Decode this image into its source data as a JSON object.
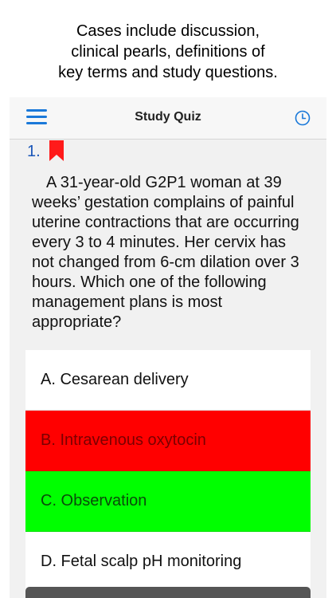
{
  "caption": {
    "line1": "Cases include discussion,",
    "line2": "clinical pearls, definitions of",
    "line3": "key terms and study questions."
  },
  "navbar": {
    "title": "Study Quiz",
    "menu_icon": "hamburger-menu-icon",
    "timer_icon": "clock-icon"
  },
  "question": {
    "number": "1.",
    "bookmark_icon": "bookmark-icon",
    "stem": "A 31-year-old G2P1 woman at 39 weeks’ gestation complains of painful uterine contractions that are occurring every 3 to 4 minutes. Her cervix has not changed from 6-cm dilation over 3 hours. Which one of the following management plans is most appropriate?"
  },
  "options": [
    {
      "label": "A. Cesarean delivery",
      "state": "neutral"
    },
    {
      "label": "B. Intravenous oxytocin",
      "state": "incorrect"
    },
    {
      "label": "C. Observation",
      "state": "correct"
    },
    {
      "label": "D. Fetal scalp pH monitoring",
      "state": "neutral"
    }
  ],
  "colors": {
    "accent": "#1a79d9",
    "number": "#1a56b8",
    "bookmark": "#ff1a1a",
    "incorrect": "#ff0000",
    "correct": "#00ff00",
    "bottom_bar": "#555555"
  }
}
